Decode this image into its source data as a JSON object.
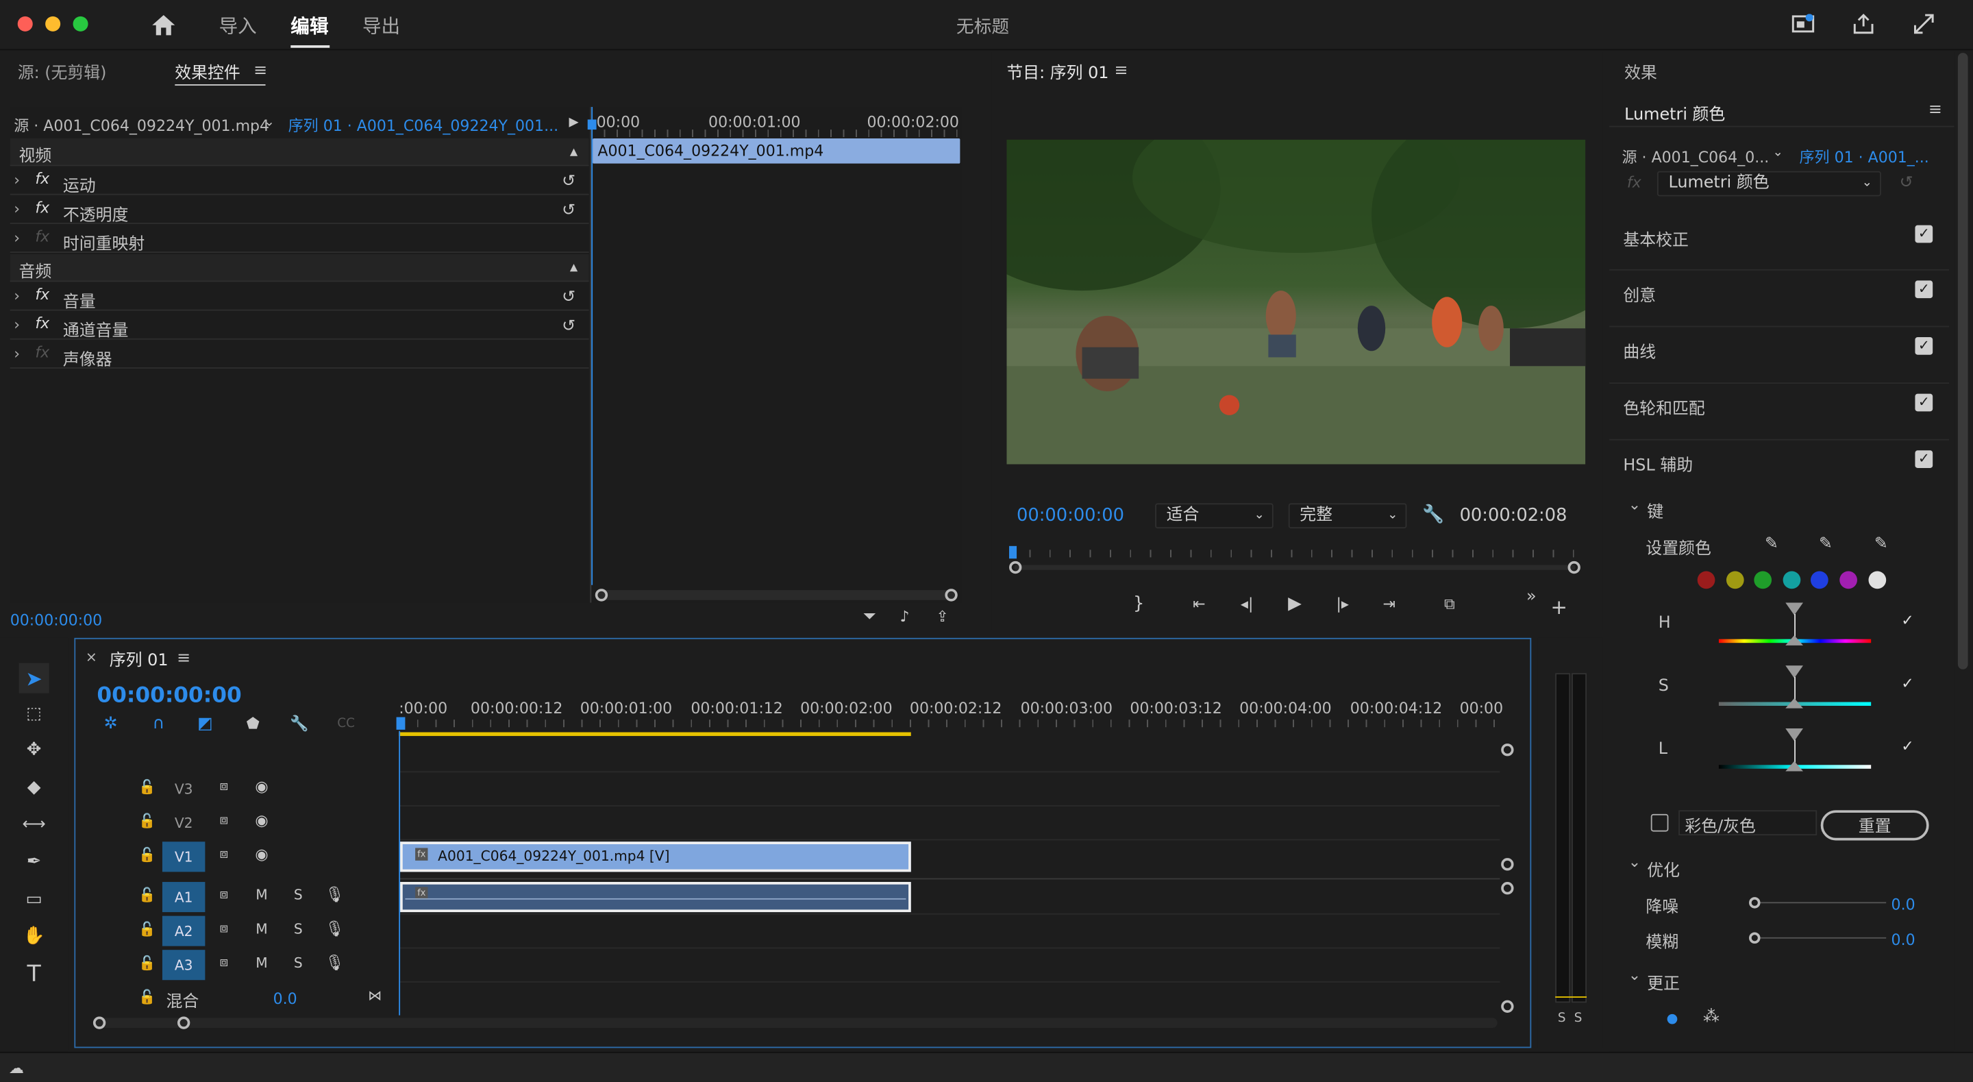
{
  "window": {
    "title": "无标题",
    "nav": [
      "导入",
      "编辑",
      "导出"
    ],
    "active_nav": "编辑"
  },
  "source_panel": {
    "tabs": [
      "源: (无剪辑)",
      "效果控件"
    ],
    "active_tab": "效果控件",
    "source_clip": "源 · A001_C064_09224Y_001.mp4",
    "sequence_clip": "序列 01 · A001_C064_09224Y_001...",
    "ruler_labels": [
      "00:00",
      "00:00:01:00",
      "00:00:02:00"
    ],
    "clip_label": "A001_C064_09224Y_001.mp4",
    "sections": [
      {
        "label": "视频",
        "items": [
          {
            "name": "运动",
            "enabled": true
          },
          {
            "name": "不透明度",
            "enabled": true
          },
          {
            "name": "时间重映射",
            "enabled": false
          }
        ]
      },
      {
        "label": "音频",
        "items": [
          {
            "name": "音量",
            "enabled": true
          },
          {
            "name": "通道音量",
            "enabled": true
          },
          {
            "name": "声像器",
            "enabled": false
          }
        ]
      }
    ],
    "timecode": "00:00:00:00"
  },
  "program_panel": {
    "title": "节目: 序列 01",
    "timecode": "00:00:00:00",
    "fit": "适合",
    "quality": "完整",
    "duration": "00:00:02:08"
  },
  "timeline": {
    "title": "序列 01",
    "timecode": "00:00:00:00",
    "ruler_labels": [
      ":00:00",
      "00:00:00:12",
      "00:00:01:00",
      "00:00:01:12",
      "00:00:02:00",
      "00:00:02:12",
      "00:00:03:00",
      "00:00:03:12",
      "00:00:04:00",
      "00:00:04:12",
      "00:00"
    ],
    "video_tracks": [
      "V3",
      "V2",
      "V1"
    ],
    "audio_tracks": [
      "A1",
      "A2",
      "A3"
    ],
    "mix_label": "混合",
    "mix_value": "0.0",
    "video_clip": "A001_C064_09224Y_001.mp4 [V]",
    "meter_labels": [
      "S",
      "S"
    ]
  },
  "effects_panel": {
    "title": "效果",
    "lumetri_title": "Lumetri 颜色",
    "source_clip": "源 · A001_C064_0...",
    "sequence_clip": "序列 01 · A001_...",
    "effect_select": "Lumetri 颜色",
    "sections": [
      "基本校正",
      "创意",
      "曲线",
      "色轮和匹配",
      "HSL 辅助"
    ],
    "key_label": "键",
    "set_color": "设置颜色",
    "hsl": [
      "H",
      "S",
      "L"
    ],
    "color_gray": "彩色/灰色",
    "reset": "重置",
    "optimize": "优化",
    "denoise": "降噪",
    "denoise_value": "0.0",
    "blur": "模糊",
    "blur_value": "0.0",
    "correct": "更正",
    "swatch_colors": [
      "#9b1c1c",
      "#a09a12",
      "#1f9d2a",
      "#13a0a0",
      "#1f3fe0",
      "#a11fb0",
      "#e0e0e0"
    ]
  }
}
